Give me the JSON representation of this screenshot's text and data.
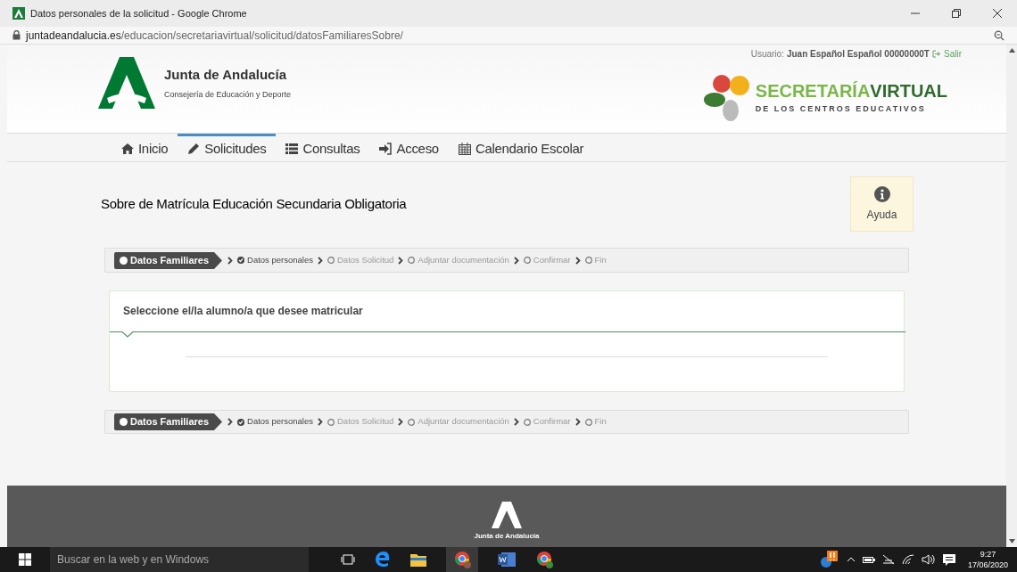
{
  "window": {
    "title": "Datos personales de la solicitud - Google Chrome"
  },
  "address_bar": {
    "host": "juntadeandalucia.es",
    "path": "/educacion/secretariavirtual/solicitud/datosFamiliaresSobre/"
  },
  "header": {
    "user_label": "Usuario:",
    "user_name": "Juan Español Español 00000000T",
    "logout": "Salir",
    "org_name": "Junta de Andalucía",
    "org_sub": "Consejería de Educación y Deporte",
    "portal_name_1": "SECRETARÍA",
    "portal_name_2": "VIRTUAL",
    "portal_sub": "DE LOS CENTROS EDUCATIVOS"
  },
  "nav": [
    {
      "label": "Inicio",
      "selected": false
    },
    {
      "label": "Solicitudes",
      "selected": true
    },
    {
      "label": "Consultas",
      "selected": false
    },
    {
      "label": "Acceso",
      "selected": false
    },
    {
      "label": "Calendario Escolar",
      "selected": false
    }
  ],
  "page_title": "Sobre de Matrícula Educación Secundaria Obligatoria",
  "help_button": "Ayuda",
  "steps_top": [
    {
      "label": "Datos Familiares",
      "kind": "current"
    },
    {
      "label": "Datos personales",
      "kind": "done"
    },
    {
      "label": "Datos Solicitud",
      "kind": "pending"
    },
    {
      "label": "Adjuntar documentación",
      "kind": "pending"
    },
    {
      "label": "Confirmar",
      "kind": "pending"
    },
    {
      "label": "Fin",
      "kind": "pending"
    }
  ],
  "card": {
    "title": "Seleccione el/la alumno/a que desee matricular"
  },
  "steps_bottom": [
    {
      "label": "Datos Familiares",
      "kind": "current"
    },
    {
      "label": "Datos personales",
      "kind": "done"
    },
    {
      "label": "Datos Solicitud",
      "kind": "pending"
    },
    {
      "label": "Adjuntar documentación",
      "kind": "pending"
    },
    {
      "label": "Confirmar",
      "kind": "pending"
    },
    {
      "label": "Fin",
      "kind": "pending"
    }
  ],
  "footer": {
    "org_name": "Junta de Andalucía"
  },
  "taskbar": {
    "search_placeholder": "Buscar en la web y en Windows",
    "time": "9:27",
    "date": "17/06/2020"
  }
}
